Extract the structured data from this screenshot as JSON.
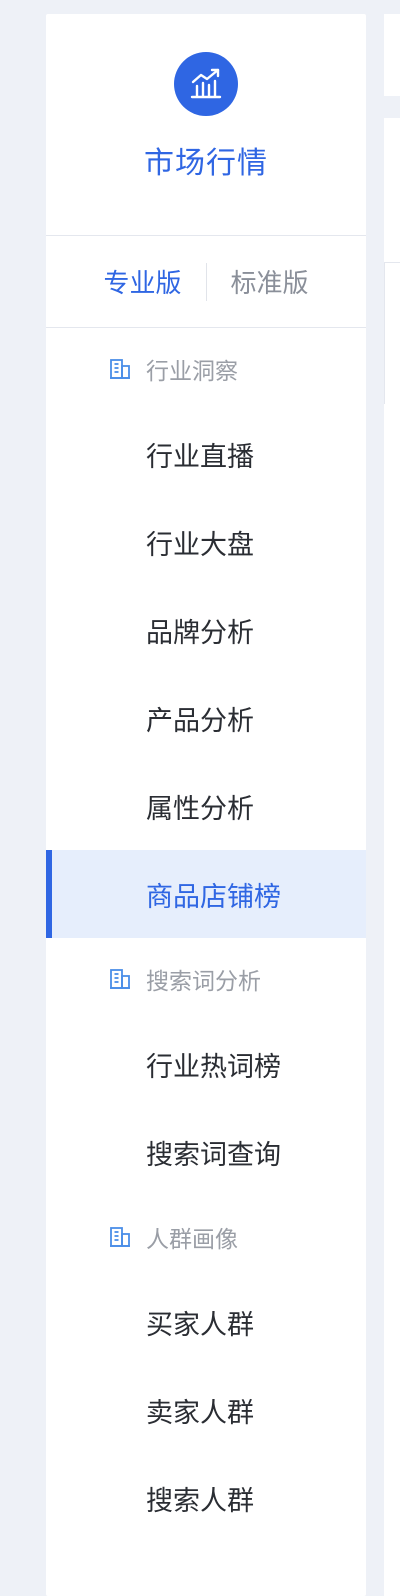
{
  "brand": {
    "title": "市场行情",
    "logo_icon": "market-chart-icon",
    "accent_color": "#2f66e3"
  },
  "versions": {
    "tabs": [
      {
        "label": "专业版",
        "active": true
      },
      {
        "label": "标准版",
        "active": false
      }
    ]
  },
  "menu": {
    "groups": [
      {
        "label": "行业洞察",
        "icon": "building-icon",
        "items": [
          {
            "label": "行业直播",
            "active": false
          },
          {
            "label": "行业大盘",
            "active": false
          },
          {
            "label": "品牌分析",
            "active": false
          },
          {
            "label": "产品分析",
            "active": false
          },
          {
            "label": "属性分析",
            "active": false
          },
          {
            "label": "商品店铺榜",
            "active": true
          }
        ]
      },
      {
        "label": "搜索词分析",
        "icon": "building-icon",
        "items": [
          {
            "label": "行业热词榜",
            "active": false
          },
          {
            "label": "搜索词查询",
            "active": false
          }
        ]
      },
      {
        "label": "人群画像",
        "icon": "building-icon",
        "items": [
          {
            "label": "买家人群",
            "active": false
          },
          {
            "label": "卖家人群",
            "active": false
          },
          {
            "label": "搜索人群",
            "active": false
          }
        ]
      }
    ]
  }
}
